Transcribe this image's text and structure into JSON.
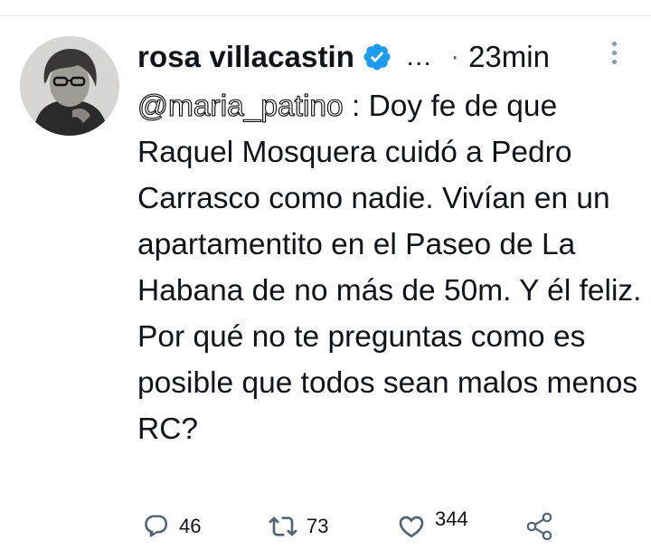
{
  "tweet": {
    "author_name": "rosa villacastin",
    "truncation": "…",
    "separator": "·",
    "time": "23min",
    "mention": "@maria_patino",
    "body": " : Doy fe de que Raquel Mosquera cuidó a Pedro Carrasco como nadie. Vivían en un apartamentito en el Paseo de La Habana de no más de 50m. Y él feliz. Por qué no te preguntas como es posible que todos sean malos menos RC?"
  },
  "actions": {
    "replies": "46",
    "retweets": "73",
    "likes": "344"
  },
  "icons": {
    "verified": "verified-badge-icon",
    "more": "more-vertical-icon",
    "reply": "reply-icon",
    "retweet": "retweet-icon",
    "like": "heart-icon",
    "share": "share-icon"
  },
  "colors": {
    "verified": "#1d9bf0",
    "secondary_text": "#536471",
    "icon_gray": "#536471"
  }
}
